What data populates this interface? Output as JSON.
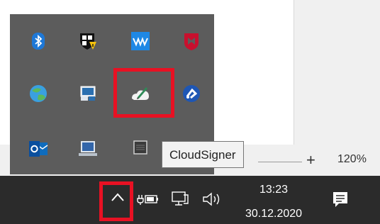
{
  "tooltip": {
    "text": "CloudSigner"
  },
  "zoom": {
    "plus_label": "+",
    "level": "120%"
  },
  "clock": {
    "time": "13:23",
    "date": "30.12.2020"
  },
  "tray_icons": [
    {
      "name": "bluetooth-icon"
    },
    {
      "name": "windows-security-icon"
    },
    {
      "name": "waves-audio-icon"
    },
    {
      "name": "mcafee-icon"
    },
    {
      "name": "globe-app-icon"
    },
    {
      "name": "remote-desktop-icon"
    },
    {
      "name": "cloudsigner-icon"
    },
    {
      "name": "blue-dots-app-icon"
    },
    {
      "name": "outlook-icon"
    },
    {
      "name": "laptop-display-icon"
    },
    {
      "name": "grey-square-icon"
    }
  ],
  "taskbar": {
    "icons": [
      "show-hidden-icons-chevron-icon",
      "battery-power-icon",
      "network-icon",
      "volume-icon",
      "action-center-notification-icon"
    ]
  },
  "colors": {
    "highlight": "#e81123",
    "flyout": "#5c5c5c",
    "taskbar": "#2b2b2b",
    "accent_blue": "#1e78d7"
  }
}
